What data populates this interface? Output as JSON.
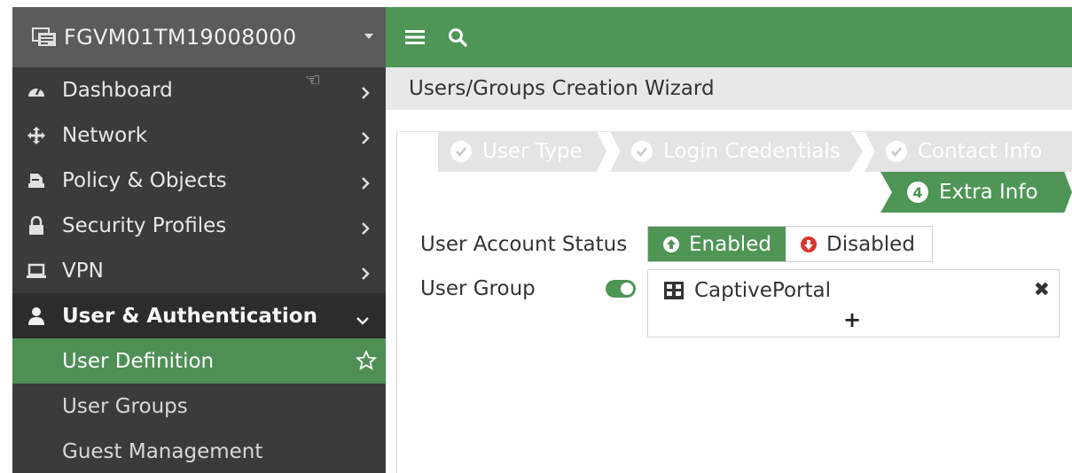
{
  "sidebar": {
    "device_name": "FGVM01TM19008000",
    "items": [
      {
        "label": "Dashboard",
        "icon": "dashboard-icon"
      },
      {
        "label": "Network",
        "icon": "network-icon"
      },
      {
        "label": "Policy & Objects",
        "icon": "policy-icon"
      },
      {
        "label": "Security Profiles",
        "icon": "lock-icon"
      },
      {
        "label": "VPN",
        "icon": "laptop-icon"
      },
      {
        "label": "User & Authentication",
        "icon": "user-icon"
      }
    ],
    "subitems": [
      {
        "label": "User Definition"
      },
      {
        "label": "User Groups"
      },
      {
        "label": "Guest Management"
      }
    ]
  },
  "topbar": {
    "menu_icon": "hamburger-icon",
    "search_icon": "search-icon"
  },
  "breadcrumb": {
    "title": "Users/Groups Creation Wizard"
  },
  "wizard": {
    "steps": [
      {
        "label": "User Type"
      },
      {
        "label": "Login Credentials"
      },
      {
        "label": "Contact Info"
      },
      {
        "number": "4",
        "label": "Extra Info"
      }
    ]
  },
  "form": {
    "account_status_label": "User Account Status",
    "enabled_label": "Enabled",
    "disabled_label": "Disabled",
    "user_group_label": "User Group",
    "group_name": "CaptivePortal",
    "add_symbol": "+",
    "remove_symbol": "✖"
  },
  "colors": {
    "accent": "#4e9556",
    "sidebar": "#3a3b3a",
    "disabled_icon": "#d9362b"
  }
}
